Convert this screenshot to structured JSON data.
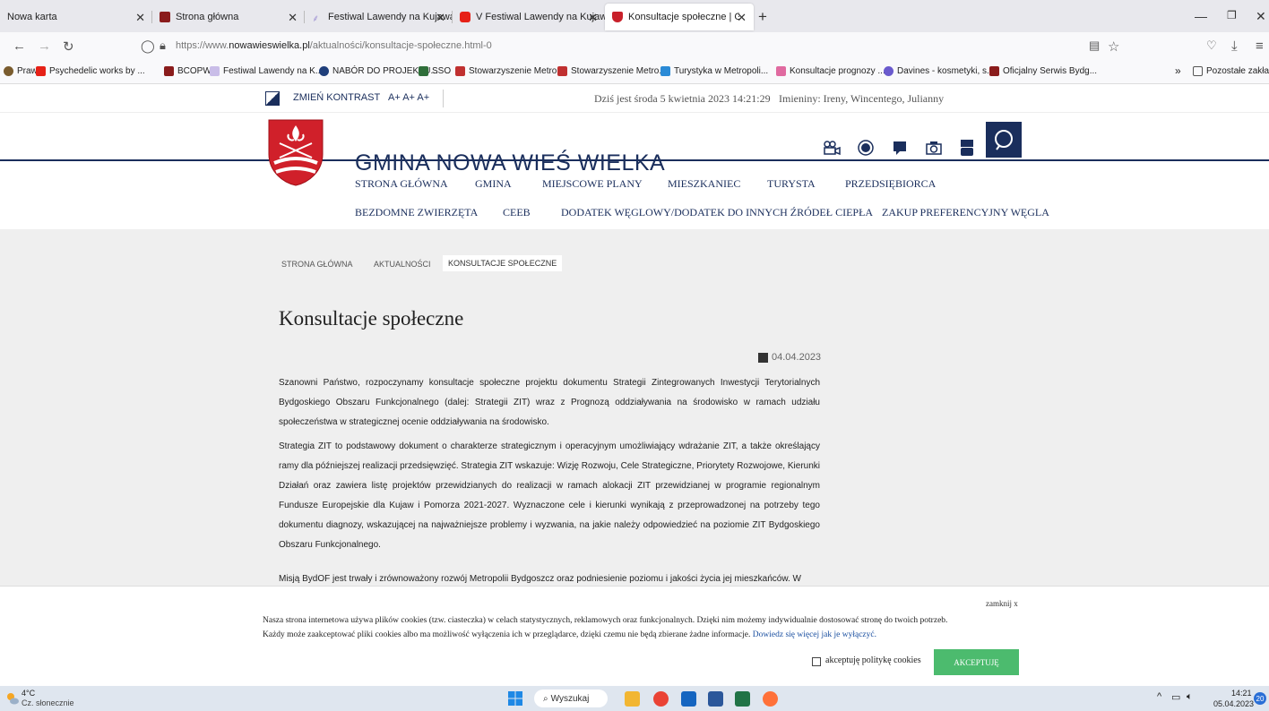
{
  "browser": {
    "tabs": [
      {
        "label": "Nowa karta",
        "icon": "blank-icon"
      },
      {
        "label": "Strona główna",
        "icon": "bcopw-icon"
      },
      {
        "label": "Festiwal Lawendy na Kujawach",
        "icon": "lavender-icon"
      },
      {
        "label": "V Festiwal Lawendy na Kujawac",
        "icon": "youtube-icon"
      },
      {
        "label": "Konsultacje społeczne | GMINA",
        "icon": "gmina-crest-icon"
      }
    ],
    "new_tab": "+",
    "url_prefix": "https://www.",
    "url_domain": "nowawieswielka.pl",
    "url_path": "/aktualności/konsultacje-społeczne.html-0",
    "bookmarks": [
      {
        "label": "Prawo"
      },
      {
        "label": "Psychedelic works by ..."
      },
      {
        "label": "BCOPW"
      },
      {
        "label": "Festiwal Lawendy na K..."
      },
      {
        "label": "NABÓR DO PROJEKTU..."
      },
      {
        "label": "SSO"
      },
      {
        "label": "Stowarzyszenie Metro..."
      },
      {
        "label": "Stowarzyszenie Metro..."
      },
      {
        "label": "Turystyka w Metropoli..."
      },
      {
        "label": "Konsultacje prognozy ..."
      },
      {
        "label": "Davines - kosmetyki, s..."
      },
      {
        "label": "Oficjalny Serwis Bydg..."
      }
    ],
    "other_bookmarks": "Pozostałe zakładki"
  },
  "topbar": {
    "contrast": "ZMIEŃ KONTRAST",
    "font_size": "A+ A+ A+",
    "date": "Dziś jest środa 5 kwietnia 2023 14:21:29",
    "namedays": "Imieniny: Ireny, Wincentego, Julianny"
  },
  "site": {
    "title": "GMINA NOWA WIEŚ WIELKA"
  },
  "menu_row1": [
    "STRONA GŁÓWNA",
    "GMINA",
    "MIEJSCOWE PLANY",
    "MIESZKANIEC",
    "TURYSTA",
    "PRZEDSIĘBIORCA"
  ],
  "menu_row2": [
    "BEZDOMNE ZWIERZĘTA",
    "CEEB",
    "DODATEK WĘGLOWY/DODATEK DO INNYCH ŹRÓDEŁ CIEPŁA",
    "ZAKUP PREFERENCYJNY WĘGLA"
  ],
  "breadcrumb": [
    "STRONA GŁÓWNA",
    "AKTUALNOŚCI",
    "KONSULTACJE SPOŁECZNE"
  ],
  "article": {
    "title": "Konsultacje społeczne",
    "date": "04.04.2023",
    "p1": "Szanowni Państwo, rozpoczynamy konsultacje społeczne projektu dokumentu Strategii Zintegrowanych Inwestycji Terytorialnych Bydgoskiego Obszaru Funkcjonalnego (dalej: Strategii ZIT) wraz z Prognozą oddziaływania na środowisko w ramach udziału społeczeństwa w strategicznej ocenie oddziaływania na środowisko.",
    "p2": "Strategia ZIT to podstawowy dokument o charakterze strategicznym i operacyjnym umożliwiający wdrażanie ZIT, a także określający ramy dla późniejszej realizacji przedsięwzięć. Strategia ZIT wskazuje: Wizję Rozwoju, Cele Strategiczne, Priorytety Rozwojowe, Kierunki Działań oraz zawiera listę projektów przewidzianych do realizacji w ramach alokacji ZIT przewidzianej w programie regionalnym Fundusze Europejskie dla Kujaw i Pomorza 2021-2027. Wyznaczone cele i kierunki wynikają z przeprowadzonej na potrzeby tego dokumentu diagnozy, wskazującej na najważniejsze problemy i wyzwania, na jakie należy odpowiedzieć na poziomie ZIT Bydgoskiego Obszaru Funkcjonalnego.",
    "p3": "Misją BydOF jest trwały i zrównoważony rozwój Metropolii Bydgoszcz oraz podniesienie poziomu i jakości życia jej mieszkańców. W"
  },
  "cookie": {
    "close": "zamknij x",
    "line1": "Nasza strona internetowa używa plików cookies (tzw. ciasteczka) w celach statystycznych, reklamowych oraz funkcjonalnych. Dzięki nim możemy indywidualnie dostosować stronę do twoich potrzeb.",
    "line2": "Każdy może zaakceptować pliki cookies albo ma możliwość wyłączenia ich w przeglądarce, dzięki czemu nie będą zbierane żadne informacje.",
    "link": "Dowiedz się więcej jak je wyłączyć.",
    "checkbox_label": "akceptuję politykę cookies",
    "accept": "AKCEPTUJĘ"
  },
  "taskbar": {
    "temp": "4°C",
    "weather": "Cz. słonecznie",
    "search": "Wyszukaj",
    "time": "14:21",
    "date": "05.04.2023",
    "notifications": "20"
  }
}
